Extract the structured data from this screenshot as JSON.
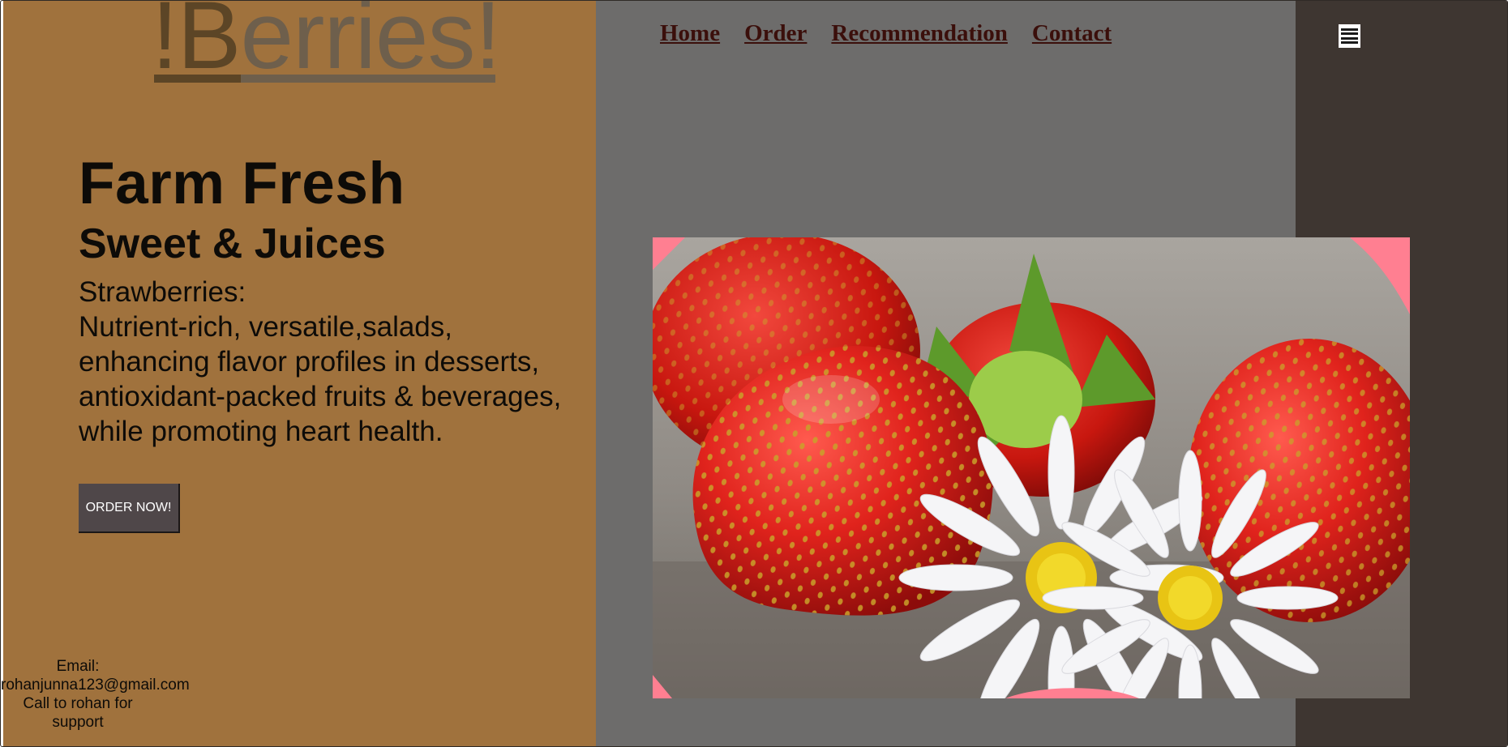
{
  "brand": {
    "logo_text_a": "!B",
    "logo_text_b": "erries!"
  },
  "nav": {
    "items": [
      {
        "label": "Home"
      },
      {
        "label": "Order"
      },
      {
        "label": "Recommendation"
      },
      {
        "label": "Contact"
      }
    ],
    "menu_icon": "hamburger-menu-icon"
  },
  "hero": {
    "title": "Farm Fresh",
    "subtitle": "Sweet & Juices",
    "description_lines": [
      "Strawberries:",
      "Nutrient-rich, versatile,salads,",
      "enhancing flavor profiles in desserts,",
      "antioxidant-packed fruits & beverages,",
      "while promoting heart health."
    ],
    "cta_label": "ORDER NOW!"
  },
  "footer": {
    "email_label": "Email:",
    "email": "rohanjunna123@gmail.com",
    "support_text": "Call to rohan for support"
  },
  "colors": {
    "left_panel": "#a0723d",
    "middle_panel": "#6d6c6b",
    "right_panel": "#3e3631",
    "nav_link": "#3b0f0b",
    "button": "#4f4749",
    "image_corner_accent": "#ff7f91"
  }
}
